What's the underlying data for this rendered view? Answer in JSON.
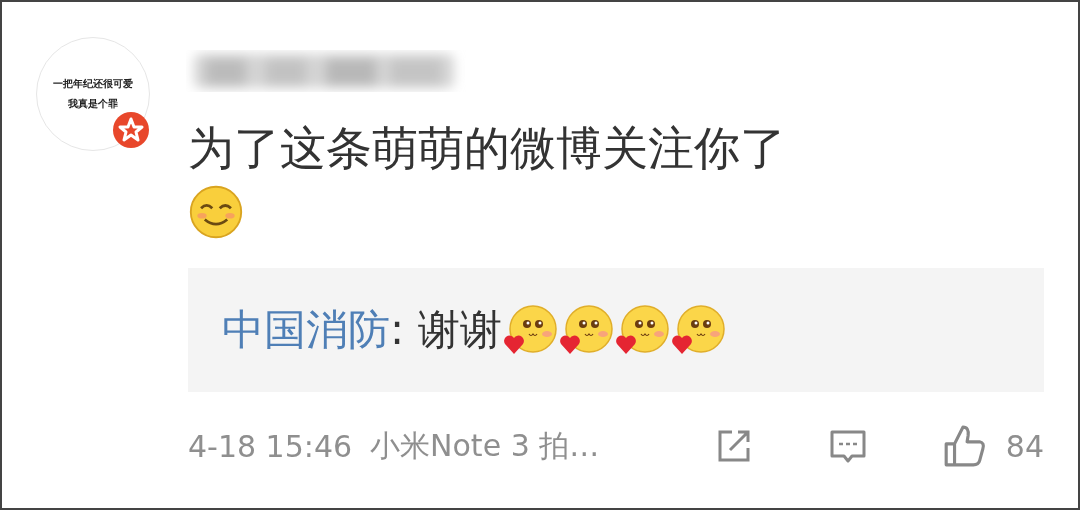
{
  "avatar": {
    "lines": [
      "一把年纪还很可爱",
      "我真是个罪"
    ],
    "verified": true
  },
  "author": {
    "blurred": true
  },
  "comment": {
    "text": "为了这条萌萌的微博关注你了",
    "emojis": [
      {
        "kind": "smile"
      }
    ]
  },
  "reply": {
    "author": "中国消防",
    "text": ": 谢谢",
    "emojis": [
      {
        "kind": "heart"
      },
      {
        "kind": "heart"
      },
      {
        "kind": "heart"
      },
      {
        "kind": "heart"
      }
    ]
  },
  "footer": {
    "time": "4-18 15:46",
    "source": "小米Note 3 拍…",
    "likes": "84"
  }
}
